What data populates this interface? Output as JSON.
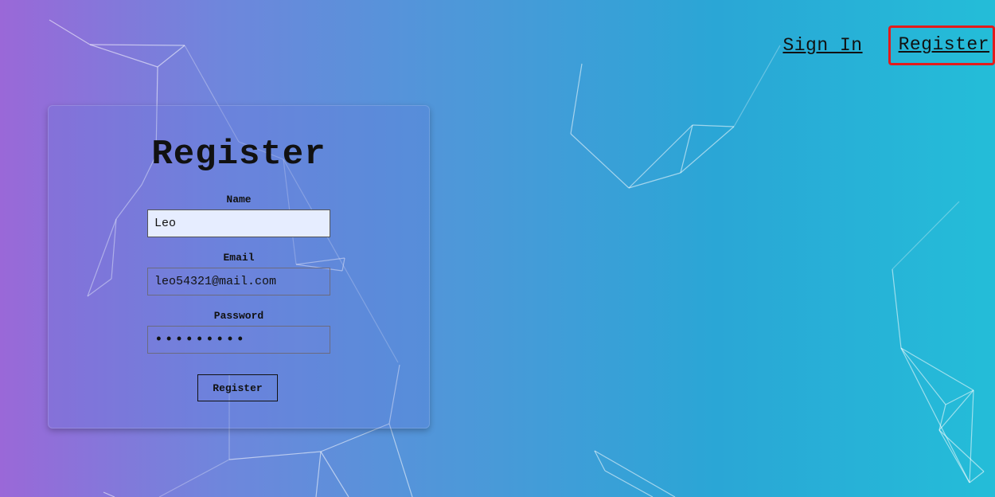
{
  "nav": {
    "sign_in": "Sign In",
    "register": "Register"
  },
  "form": {
    "title": "Register",
    "name": {
      "label": "Name",
      "value": "Leo"
    },
    "email": {
      "label": "Email",
      "value": "leo54321@mail.com"
    },
    "password": {
      "label": "Password",
      "value": "•••••••••"
    },
    "submit_label": "Register"
  },
  "colors": {
    "gradient_start": "#9a68d8",
    "gradient_end": "#24bdd8",
    "highlight": "#e31b1b"
  }
}
